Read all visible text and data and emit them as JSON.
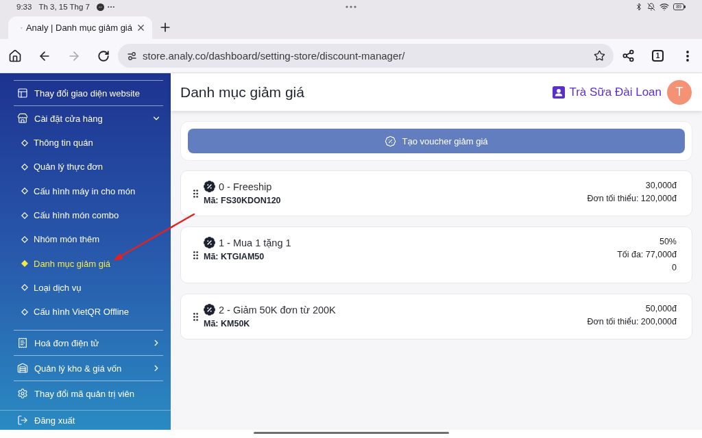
{
  "status_bar": {
    "time": "9:33",
    "date": "Th 3, 15 Thg 7",
    "battery": "89"
  },
  "browser": {
    "tabs": [
      {
        "title": "Analy | Danh mục giảm giá",
        "selected": true
      }
    ],
    "forward_disabled": true,
    "url": "store.analy.co/dashboard/setting-store/discount-manager/",
    "tab_count": "1"
  },
  "sidebar": {
    "items": [
      {
        "kind": "link",
        "label": "Thay đổi giao diện website"
      },
      {
        "kind": "group",
        "label": "Cài đặt cửa hàng",
        "expanded": true,
        "children": [
          {
            "label": "Thông tin quán",
            "selected": false
          },
          {
            "label": "Quản lý thực đơn",
            "selected": false
          },
          {
            "label": "Cấu hình máy in cho món",
            "selected": false
          },
          {
            "label": "Cấu hình món combo",
            "selected": false
          },
          {
            "label": "Nhóm món thêm",
            "selected": false
          },
          {
            "label": "Danh mục giảm giá",
            "selected": true
          },
          {
            "label": "Loại dịch vụ",
            "selected": false
          },
          {
            "label": "Cấu hình VietQR Offline",
            "selected": false
          }
        ]
      },
      {
        "kind": "group",
        "label": "Hoá đơn điện tử",
        "expanded": false
      },
      {
        "kind": "group",
        "label": "Quản lý kho & giá vốn",
        "expanded": false
      },
      {
        "kind": "link",
        "label": "Thay đổi mã quản trị viên"
      }
    ],
    "footer": {
      "label": "Đăng xuất"
    }
  },
  "header": {
    "title": "Danh mục giảm giá",
    "store_name": "Trà Sữa Đài Loan",
    "avatar_initial": "T"
  },
  "create_button": {
    "label": "Tạo voucher giảm giá"
  },
  "vouchers": [
    {
      "title": "0 - Freeship",
      "code": "Mã: FS30KDON120",
      "details": [
        "30,000đ",
        "Đơn tối thiểu: 120,000đ"
      ]
    },
    {
      "title": "1 - Mua 1 tặng 1",
      "code": "Mã: KTGIAM50",
      "details": [
        "50%",
        "Tối đa: 77,000đ",
        "0"
      ]
    },
    {
      "title": "2 - Giảm 50K đơn từ 200K",
      "code": "Mã: KM50K",
      "details": [
        "50,000đ",
        "Đơn tối thiểu: 200,000đ"
      ]
    }
  ]
}
